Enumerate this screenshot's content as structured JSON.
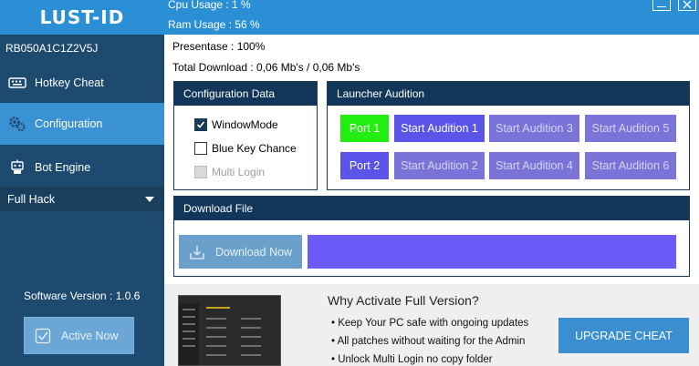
{
  "app": {
    "title": "LUST-ID",
    "serial": "RB050A1C1Z2V5J"
  },
  "sidebar": {
    "items": [
      {
        "label": "Hotkey Cheat",
        "icon": "keyboard-icon"
      },
      {
        "label": "Configuration",
        "icon": "gears-icon"
      },
      {
        "label": "Bot Engine",
        "icon": "robot-icon"
      }
    ],
    "dropdown": {
      "selected": "Full Hack"
    },
    "version": "Software Version : 1.0.6",
    "active_button": "Active Now"
  },
  "status": {
    "cpu": "Cpu Usage : 1 %",
    "ram": "Ram Usage : 56 %",
    "presentase": "Presentase : 100%",
    "total_download": "Total Download : 0,06 Mb's / 0,06 Mb's"
  },
  "config": {
    "title": "Configuration Data",
    "options": [
      {
        "label": "WindowMode",
        "checked": true,
        "enabled": true
      },
      {
        "label": "Blue Key Chance",
        "checked": false,
        "enabled": true
      },
      {
        "label": "Multi Login",
        "checked": false,
        "enabled": false
      }
    ]
  },
  "launcher": {
    "title": "Launcher Audition",
    "port1": "Port 1",
    "port2": "Port 2",
    "auditions": [
      "Start Audition 1",
      "Start Audition 2",
      "Start Audition 3",
      "Start Audition 4",
      "Start Audition 5",
      "Start Audition 6"
    ]
  },
  "download": {
    "title": "Download File",
    "button": "Download Now",
    "progress": 1.0
  },
  "promo": {
    "title": "Why Activate Full Version?",
    "bullets": [
      "• Keep Your PC safe with ongoing updates",
      "• All patches without waiting for the Admin",
      "• Unlock Multi Login no copy folder"
    ],
    "upgrade": "UPGRADE CHEAT"
  },
  "colors": {
    "sidebar": "#1d4a6e",
    "accent": "#2b8fd6",
    "panel_header": "#12365a",
    "port_active": "#22ee11",
    "audition": "#5a54e8",
    "progress": "#6b5cf7"
  }
}
